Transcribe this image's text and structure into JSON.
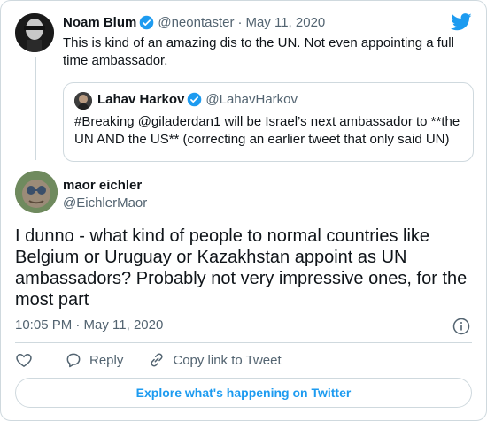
{
  "parent_tweet": {
    "name": "Noam Blum",
    "handle": "@neontaster",
    "separator": "·",
    "date": "May 11, 2020",
    "text": "This is kind of an amazing dis to the UN. Not even appointing a full time ambassador."
  },
  "quoted_tweet": {
    "name": "Lahav Harkov",
    "handle": "@LahavHarkov",
    "text": "#Breaking @giladerdan1 will be Israel’s next ambassador to **the UN AND the US** (correcting an earlier tweet that only said UN)"
  },
  "main_tweet": {
    "name": "maor eichler",
    "handle": "@EichlerMaor",
    "text": "I dunno - what kind of people to normal countries like Belgium or Uruguay or Kazakhstan appoint as UN ambassadors? Probably not very impressive ones, for the most part",
    "timestamp": "10:05 PM · May 11, 2020"
  },
  "actions": {
    "reply_label": "Reply",
    "copy_link_label": "Copy link to Tweet"
  },
  "explore_label": "Explore what's happening on Twitter",
  "icons": {
    "brand": "twitter-bird-icon",
    "verified": "verified-badge-icon",
    "info": "info-icon",
    "like": "heart-icon",
    "reply": "reply-bubble-icon",
    "copy": "link-icon"
  },
  "colors": {
    "accent": "#1d9bf0",
    "text": "#0f1419",
    "secondary": "#536471",
    "border": "#cfd9de"
  }
}
